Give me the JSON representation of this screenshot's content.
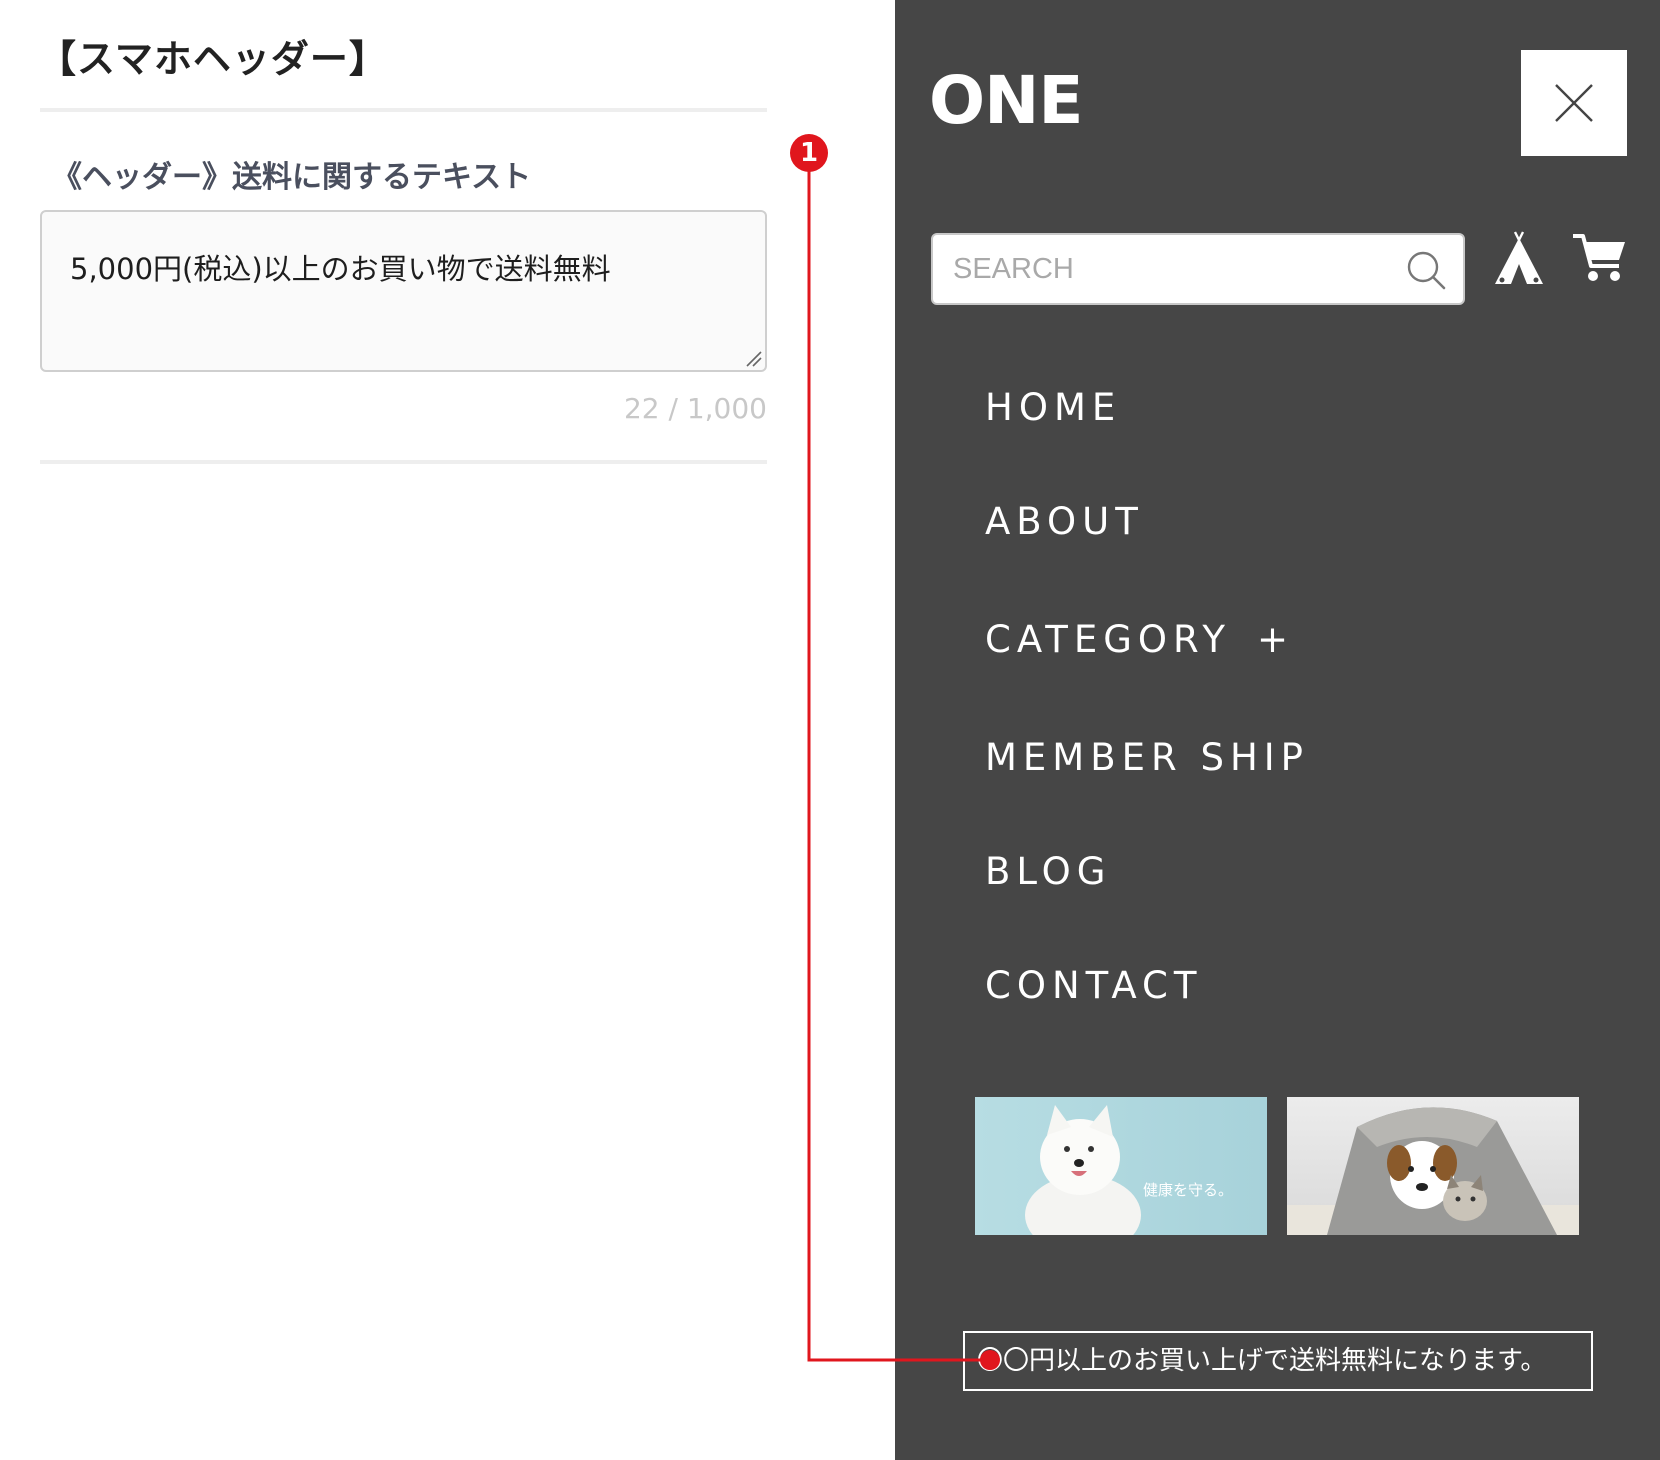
{
  "settings": {
    "title": "【スマホヘッダー】",
    "field_label": "《ヘッダー》送料に関するテキスト",
    "field_value": "5,000円(税込)以上のお買い物で送料無料",
    "char_count": "22 / 1,000"
  },
  "annotation": {
    "badge": "1",
    "color": "#e0161d"
  },
  "drawer": {
    "logo": "ONE",
    "background": "#464646",
    "search": {
      "placeholder": "SEARCH"
    },
    "icons": [
      "close-icon",
      "search-icon",
      "tent-icon",
      "cart-icon"
    ],
    "nav": [
      {
        "label": "HOME"
      },
      {
        "label": "ABOUT"
      },
      {
        "label": "CATEGORY",
        "suffix": "+"
      },
      {
        "label": "MEMBER SHIP"
      },
      {
        "label": "BLOG"
      },
      {
        "label": "CONTACT"
      }
    ],
    "banners": [
      {
        "caption": "健康を守る。"
      },
      {
        "caption": ""
      }
    ],
    "notice": "〇〇円以上のお買い上げで送料無料になります。"
  }
}
